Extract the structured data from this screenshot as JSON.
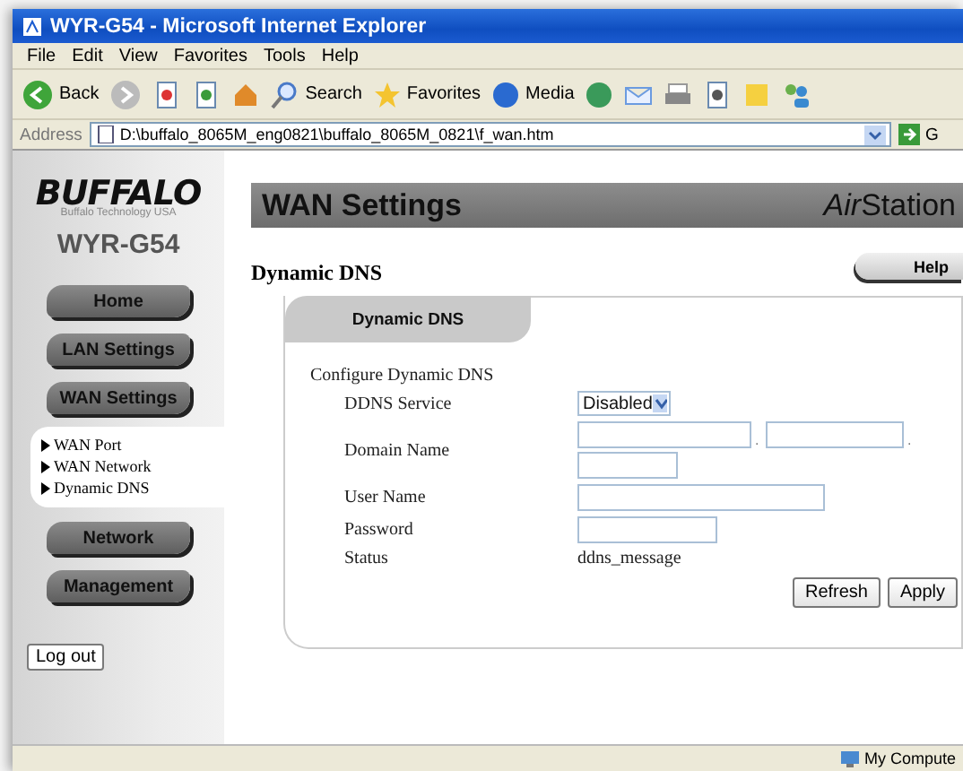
{
  "window": {
    "title": "WYR-G54 - Microsoft Internet Explorer"
  },
  "menu": [
    "File",
    "Edit",
    "View",
    "Favorites",
    "Tools",
    "Help"
  ],
  "toolbar": [
    {
      "kind": "back",
      "label": "Back"
    },
    {
      "kind": "forward"
    },
    {
      "kind": "stop"
    },
    {
      "kind": "refresh"
    },
    {
      "kind": "home"
    },
    {
      "kind": "search",
      "label": "Search"
    },
    {
      "kind": "favorites",
      "label": "Favorites"
    },
    {
      "kind": "media",
      "label": "Media"
    },
    {
      "kind": "history"
    },
    {
      "kind": "mail"
    },
    {
      "kind": "print"
    },
    {
      "kind": "edit"
    },
    {
      "kind": "notes"
    },
    {
      "kind": "messenger"
    }
  ],
  "address": {
    "label": "Address",
    "value": "D:\\buffalo_8065M_eng0821\\buffalo_8065M_0821\\f_wan.htm",
    "go": "G"
  },
  "sidebar": {
    "brand": "BUFFALO",
    "tagline": "Buffalo Technology USA",
    "model": "WYR-G54",
    "nav": [
      {
        "label": "Home"
      },
      {
        "label": "LAN Settings"
      },
      {
        "label": "WAN Settings",
        "children": [
          "WAN Port",
          "WAN Network",
          "Dynamic DNS"
        ]
      },
      {
        "label": "Network"
      },
      {
        "label": "Management"
      }
    ],
    "logout": "Log out"
  },
  "main": {
    "title": "WAN Settings",
    "brand_prefix": "Air",
    "brand": "Station",
    "section_title": "Dynamic DNS",
    "help": "Help",
    "tab": "Dynamic DNS",
    "intro": "Configure Dynamic DNS",
    "fields": [
      {
        "kind": "select",
        "label": "DDNS Service",
        "value": "Disabled"
      },
      {
        "kind": "domain",
        "label": "Domain Name",
        "separators": [
          ".",
          "."
        ]
      },
      {
        "kind": "text",
        "label": "User Name"
      },
      {
        "kind": "password",
        "label": "Password"
      },
      {
        "kind": "status",
        "label": "Status",
        "value": "ddns_message"
      }
    ],
    "buttons": [
      "Refresh",
      "Apply"
    ]
  },
  "status_bar": {
    "zone": "My Compute"
  }
}
